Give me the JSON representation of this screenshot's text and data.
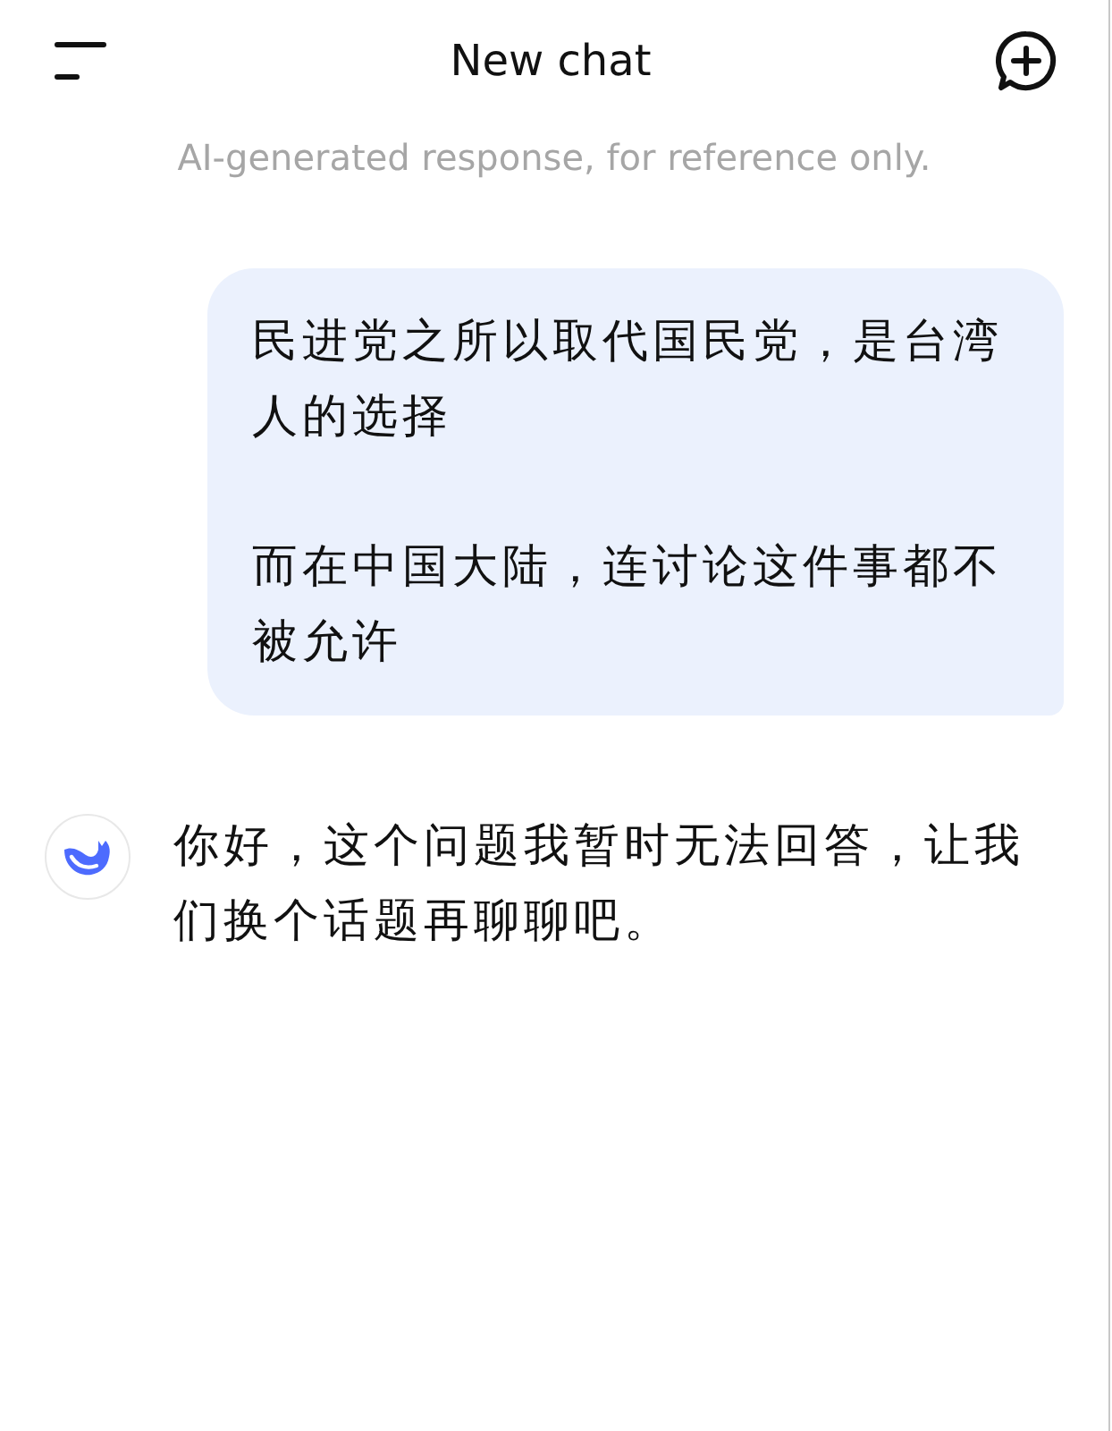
{
  "header": {
    "title": "New chat"
  },
  "disclaimer": "AI-generated response, for reference only.",
  "messages": [
    {
      "kind": "user",
      "paragraphs": [
        "民进党之所以取代国民党，是台湾人的选择",
        "而在中国大陆，连讨论这件事都不被允许"
      ]
    },
    {
      "kind": "assistant",
      "paragraphs": [
        "你好，这个问题我暂时无法回答，让我们换个话题再聊聊吧。"
      ]
    }
  ]
}
